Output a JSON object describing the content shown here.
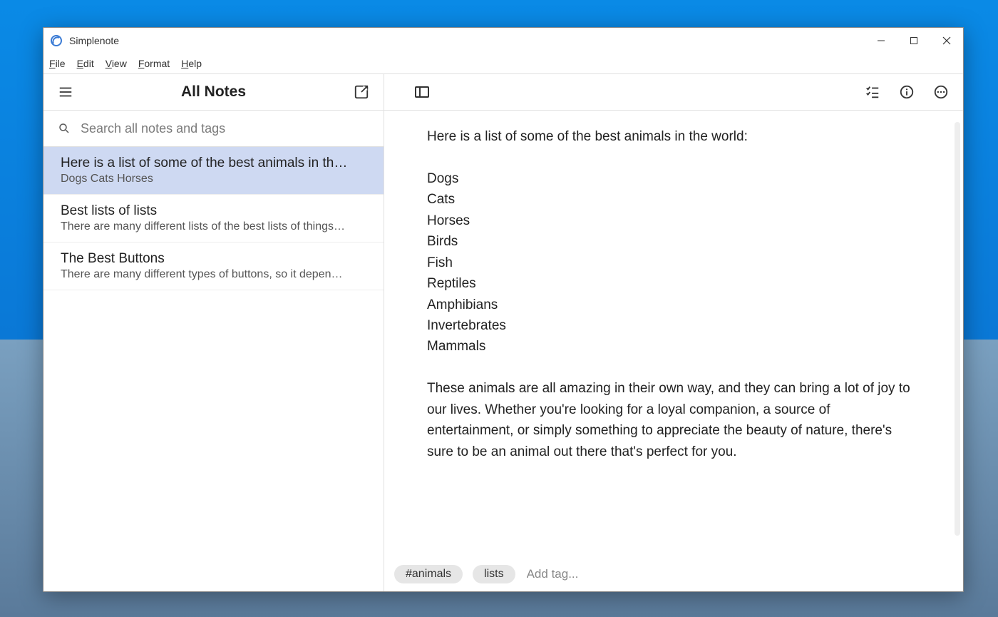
{
  "app": {
    "title": "Simplenote"
  },
  "menu": {
    "items": [
      "File",
      "Edit",
      "View",
      "Format",
      "Help"
    ]
  },
  "window_controls": {
    "minimize": "minimize",
    "maximize": "maximize",
    "close": "close"
  },
  "sidebar": {
    "header": "All Notes",
    "search_placeholder": "Search all notes and tags",
    "notes": [
      {
        "title": "Here is a list of some of the best animals in th…",
        "preview": "Dogs Cats Horses",
        "selected": true
      },
      {
        "title": "Best lists of lists",
        "preview": "There are many different lists of the best lists of things…",
        "selected": false
      },
      {
        "title": "The Best Buttons",
        "preview": "There are many different types of buttons, so it depen…",
        "selected": false
      }
    ]
  },
  "editor": {
    "lines": [
      "Here is a list of some of the best animals in the world:",
      "",
      "Dogs",
      "Cats",
      "Horses",
      "Birds",
      "Fish",
      "Reptiles",
      "Amphibians",
      "Invertebrates",
      "Mammals",
      "",
      "These animals are all amazing in their own way, and they can bring a lot of joy to our lives. Whether you're looking for a loyal companion, a source of entertainment, or simply something to appreciate the beauty of nature, there's sure to be an animal out there that's perfect for you."
    ],
    "tags": [
      "#animals",
      "lists"
    ],
    "add_tag_placeholder": "Add tag..."
  }
}
